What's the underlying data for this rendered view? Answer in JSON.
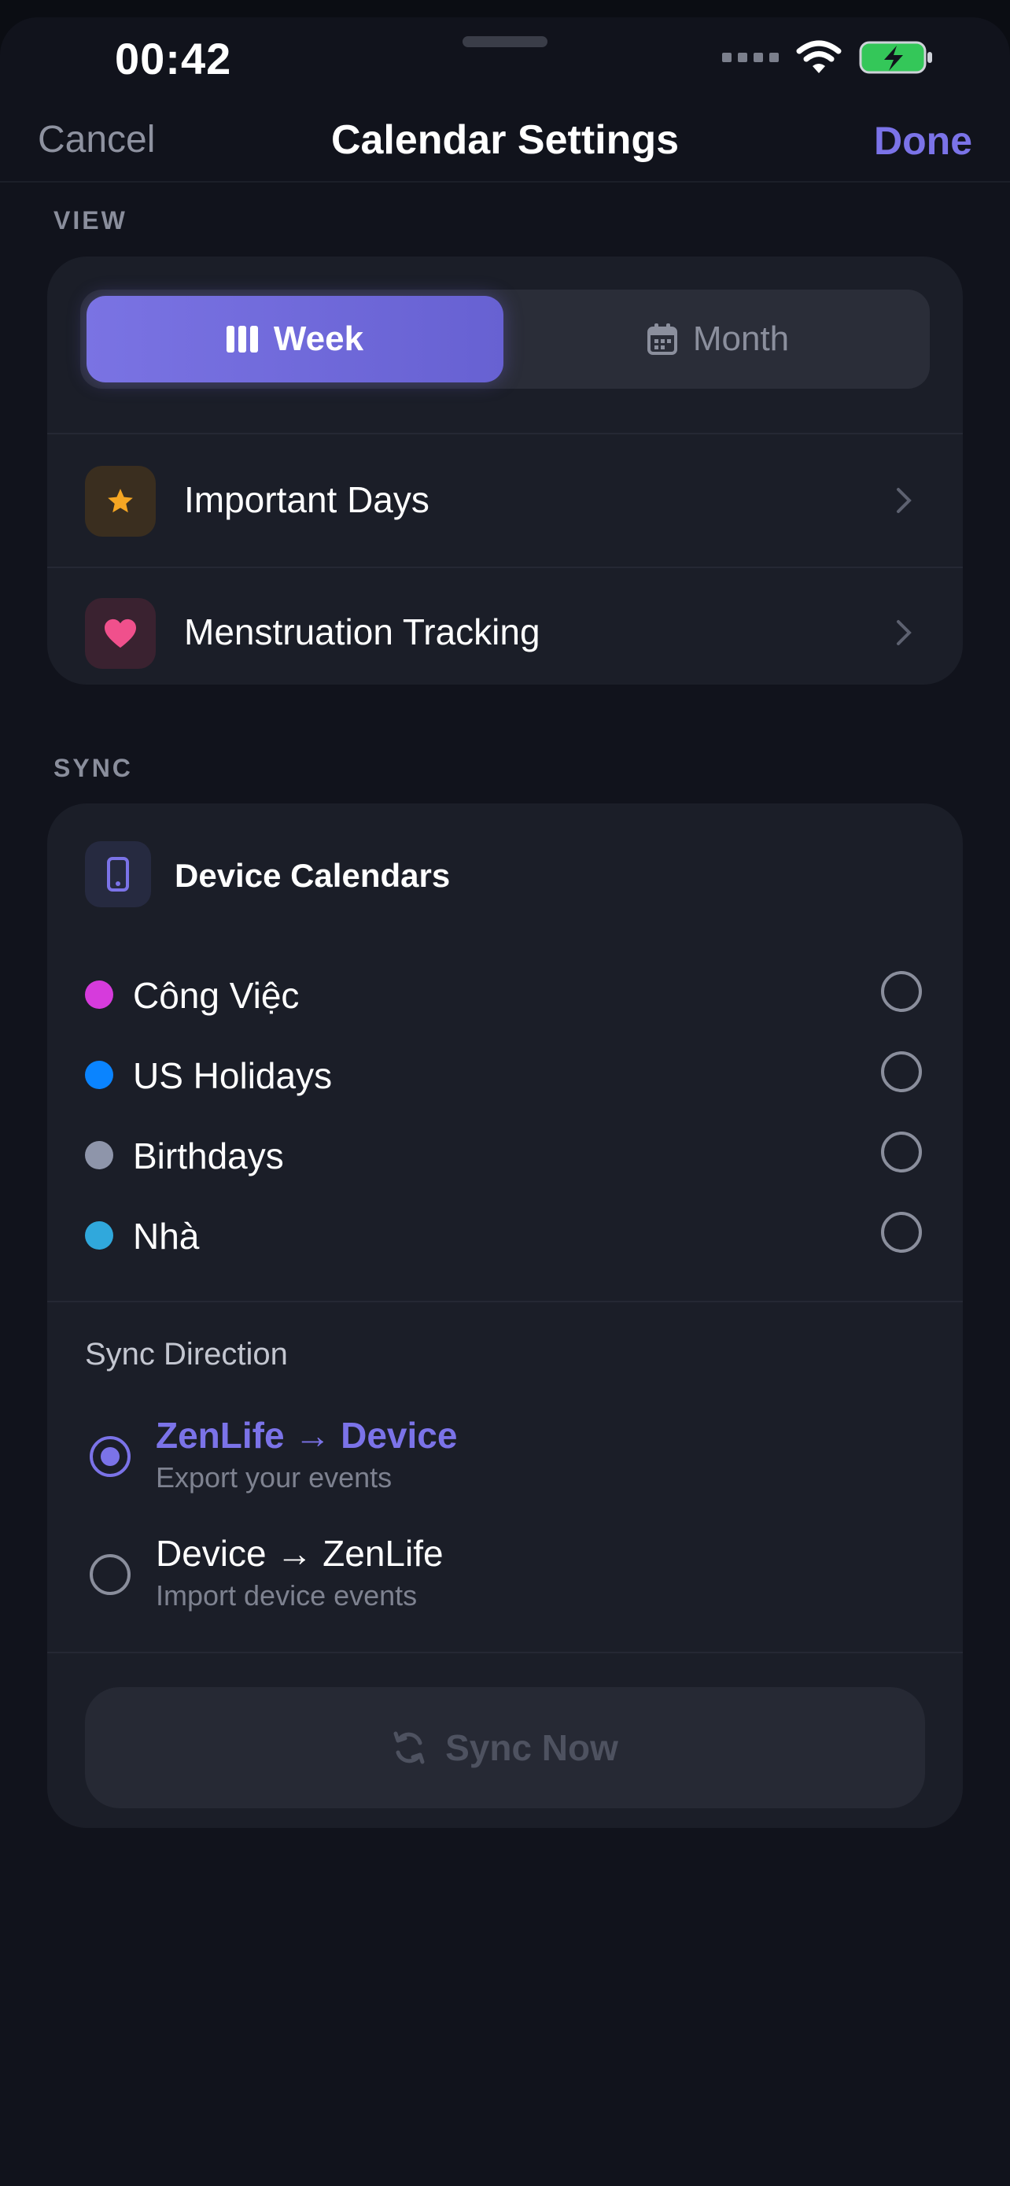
{
  "status_bar": {
    "time": "00:42"
  },
  "nav": {
    "cancel_label": "Cancel",
    "title": "Calendar Settings",
    "done_label": "Done"
  },
  "view_section": {
    "label": "VIEW",
    "segments": {
      "week": "Week",
      "month": "Month",
      "selected": "Week"
    },
    "rows": [
      {
        "label": "Important Days",
        "icon": "star-icon",
        "icon_color": "#f5a623"
      },
      {
        "label": "Menstruation Tracking",
        "icon": "heart-icon",
        "icon_color": "#f0508c"
      }
    ]
  },
  "sync_section": {
    "label": "SYNC",
    "device_calendars_title": "Device Calendars",
    "calendars": [
      {
        "name": "Công Việc",
        "color": "#d63bdc",
        "checked": false
      },
      {
        "name": "US Holidays",
        "color": "#0a84ff",
        "checked": false
      },
      {
        "name": "Birthdays",
        "color": "#8e95aa",
        "checked": false
      },
      {
        "name": "Nhà",
        "color": "#30a8dc",
        "checked": false
      }
    ],
    "sync_direction_label": "Sync Direction",
    "options": [
      {
        "title": "ZenLife → Device",
        "subtitle": "Export your events",
        "selected": true
      },
      {
        "title": "Device → ZenLife",
        "subtitle": "Import device events",
        "selected": false
      }
    ],
    "sync_button_label": "Sync Now"
  },
  "colors": {
    "accent": "#7b73e8",
    "background": "#11131c",
    "card": "#1b1e28"
  }
}
